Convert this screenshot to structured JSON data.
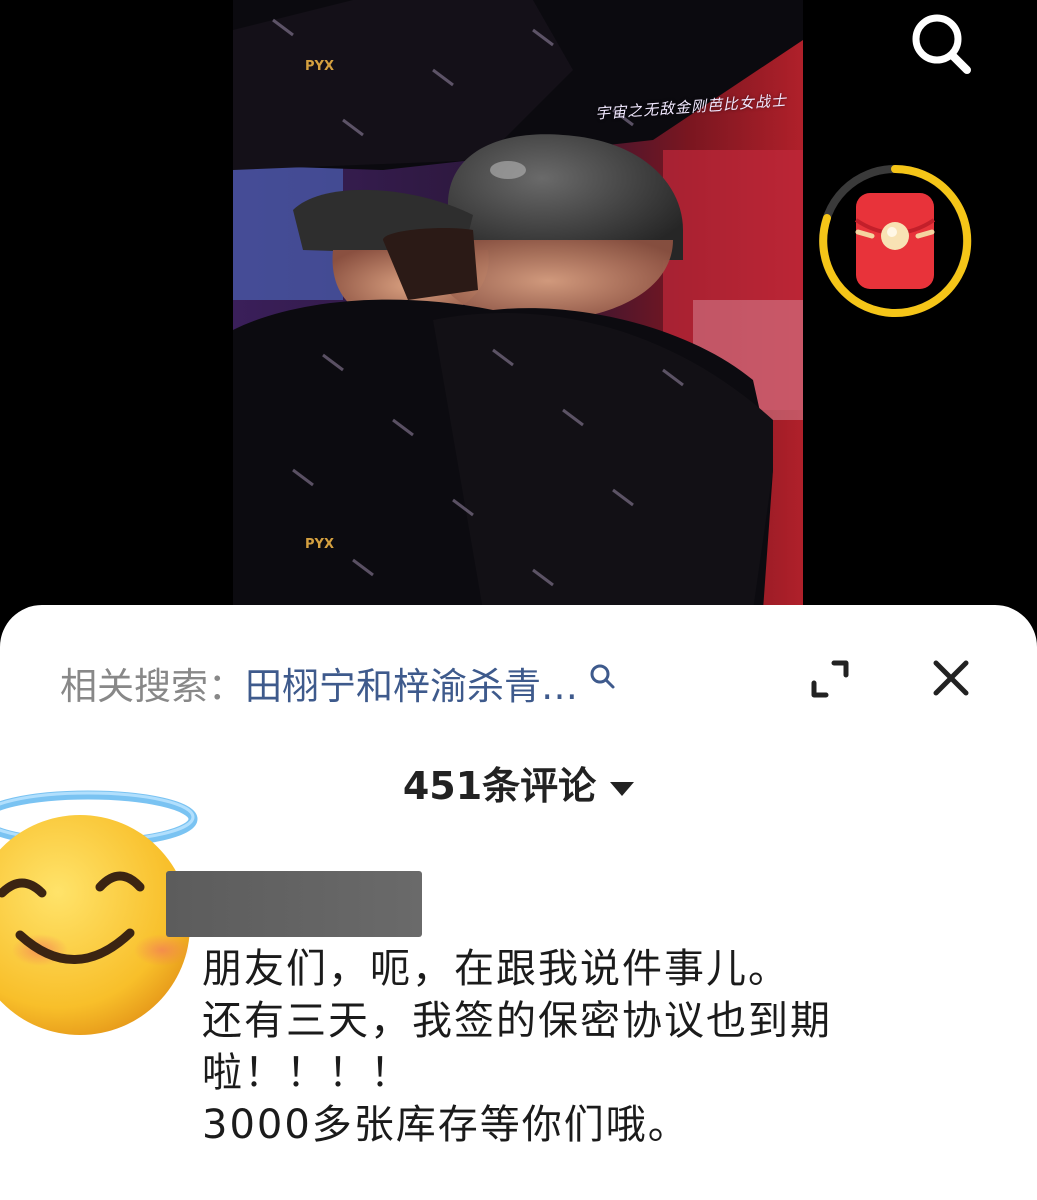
{
  "video": {
    "watermark": "宇宙之无敌金刚芭比女战士",
    "overlay_logo": "PYX",
    "search_icon": "search-icon",
    "red_packet_icon": "red-envelope-icon"
  },
  "related_search": {
    "label": "相关搜索：",
    "query": "田栩宁和梓渝杀青…",
    "icon": "search-icon"
  },
  "controls": {
    "expand_icon": "expand-icon",
    "close_icon": "close-icon"
  },
  "comments": {
    "count_label": "451条评论"
  },
  "comment": {
    "avatar_icon": "smiling-face-with-halo-icon",
    "lines": [
      "朋友们，呃，在跟我说件事儿。",
      "还有三天，我签的保密协议也到期",
      "啦！！！！",
      "3000多张库存等你们哦。"
    ]
  },
  "colors": {
    "accent_link": "#3e5a8c",
    "red_packet": "#e8333a",
    "ring": "#f5c518",
    "sheet_bg": "#ffffff"
  }
}
